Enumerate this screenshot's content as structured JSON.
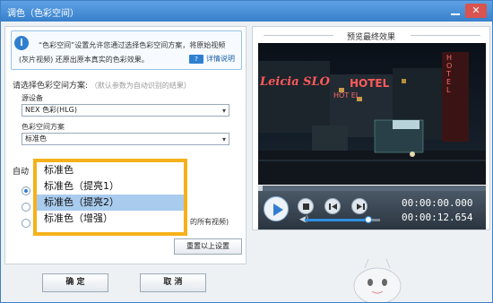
{
  "window": {
    "title": "调色（色彩空间）"
  },
  "info": {
    "text1": "“色彩空间”设置允许您通过选择色彩空间方案，将原始视频",
    "text2": "(灰片视频) 还原出原本真实的色彩效果。",
    "help": "详情说明",
    "help_icon_label": "?"
  },
  "form": {
    "section_title": "请选择色彩空间方案:",
    "section_note": "（默认参数为自动识别的结果）",
    "source_label": "源设备",
    "source_value": "NEX 色彩(HLG)",
    "scheme_label": "色彩空间方案",
    "scheme_value": "标准色",
    "auto_title": "自动",
    "tail_text": "的所有视频)"
  },
  "dropdown": {
    "items": [
      "标准色",
      "标准色（提亮1）",
      "标准色（提亮2）",
      "标准色（增强）"
    ],
    "selected_index": 2
  },
  "buttons": {
    "reset": "重置以上设置",
    "ok": "确 定",
    "cancel": "取 消"
  },
  "preview": {
    "title": "预览最终效果",
    "time_current": "00:00:00.000",
    "time_total": "00:00:12.654",
    "progress": 0.02,
    "volume": 0.85,
    "sign_text": "Leicia SLO",
    "sign_hotel": "HOTEL",
    "sign_hot_el": "HOT EL",
    "sign_vertical": "HOT EL"
  },
  "colors": {
    "accent": "#3f7fc6",
    "highlight": "#f5b11b",
    "selected_item": "#a9cbee"
  }
}
